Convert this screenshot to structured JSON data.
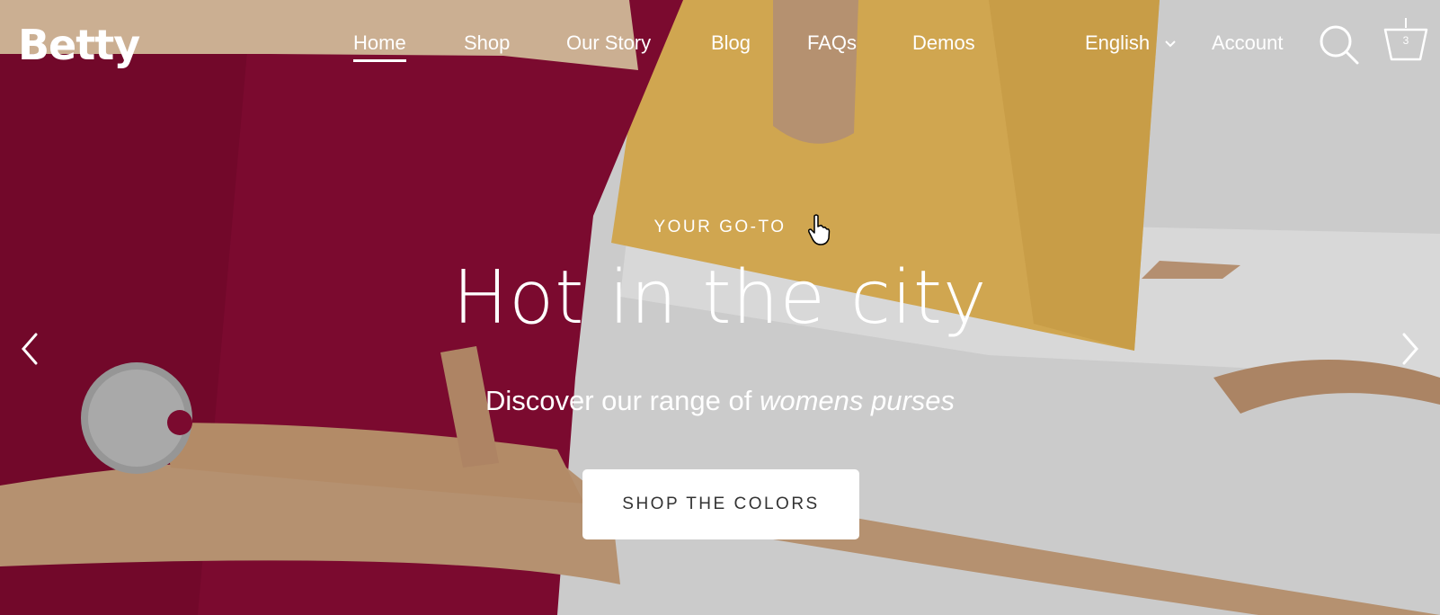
{
  "brand": {
    "name": "Betty"
  },
  "nav": {
    "items": [
      {
        "label": "Home",
        "active": true
      },
      {
        "label": "Shop"
      },
      {
        "label": "Our Story"
      },
      {
        "label": "Blog"
      },
      {
        "label": "FAQs"
      },
      {
        "label": "Demos"
      }
    ],
    "language": "English",
    "account": "Account",
    "search_icon": "search-icon",
    "cart_icon": "basket-icon",
    "cart_count": "3"
  },
  "hero": {
    "eyebrow": "YOUR GO-TO",
    "title": "Hot in the city",
    "subtitle_main": "Discover our range of ",
    "subtitle_italic": "womens purses",
    "cta": "SHOP THE COLORS",
    "prev_icon": "chevron-left-icon",
    "next_icon": "chevron-right-icon"
  },
  "colors": {
    "burgundy": "#8a0c35",
    "mustard": "#e8b95a",
    "tan": "#c79b75",
    "white_bag": "#ececec"
  }
}
